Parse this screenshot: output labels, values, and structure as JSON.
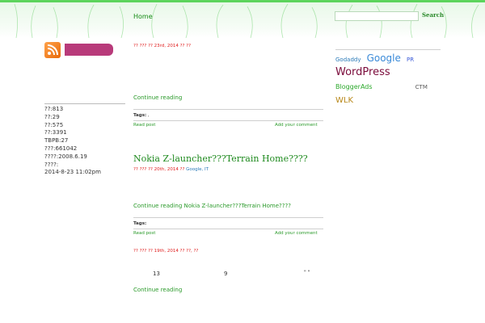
{
  "header": {
    "logo": "",
    "tagline": "",
    "nav": [
      {
        "label": "Home",
        "active": true
      },
      {
        "label": "",
        "active": false
      },
      {
        "label": "",
        "active": false
      },
      {
        "label": "",
        "active": false
      }
    ],
    "search": {
      "placeholder": "",
      "button": "Search"
    }
  },
  "sidebar": {
    "rss_label": "",
    "heading": "",
    "stats": [
      "??:813",
      "??:29",
      "??:575",
      "??:3391",
      "TBPB:27",
      "???:661042",
      "????:2008.6.19",
      "????:",
      "2014-8-23 11:02pm"
    ]
  },
  "posts": [
    {
      "title": "",
      "meta": "?? ??? ?? 23rd, 2014 ?? ??",
      "meta_link": "",
      "body": "",
      "more": "Continue reading ",
      "tags_label": "Tags:",
      "tags": [],
      "read": "Read post",
      "comment": "Add your comment"
    },
    {
      "title": "Nokia Z-launcher???Terrain Home????",
      "meta": "?? ??? ?? 20th, 2014 ?? ",
      "meta_link": "Google, IT",
      "body": "",
      "more": "Continue reading Nokia Z-launcher???Terrain Home????",
      "tags_label": "Tags:",
      "read": "Read post",
      "comment": "Add your comment"
    },
    {
      "title": "",
      "meta": "?? ??? ?? 19th, 2014 ?? ??, ??",
      "numbers": [
        "13",
        "9",
        "\" \""
      ],
      "more": "Continue reading "
    }
  ],
  "tagcloud": {
    "title": "",
    "tags": [
      {
        "label": "Godaddy",
        "size": 7,
        "color": "#2a7ab8"
      },
      {
        "label": "Google",
        "size": 12,
        "color": "#3a8ad8"
      },
      {
        "label": "PR",
        "size": 7,
        "color": "#3a5ad8"
      },
      {
        "label": "WordPress",
        "size": 13,
        "color": "#7a0a3a"
      },
      {
        "label": "",
        "size": 13,
        "color": "#1a3ad8"
      },
      {
        "label": "",
        "size": 8,
        "color": "#d83ab8"
      },
      {
        "label": "",
        "size": 6,
        "color": "#333333"
      },
      {
        "label": "",
        "size": 6,
        "color": "#333333"
      },
      {
        "label": "",
        "size": 7,
        "color": "#c87a1a"
      },
      {
        "label": "",
        "size": 6,
        "color": "#333333"
      },
      {
        "label": "",
        "size": 8,
        "color": "#5aa83a"
      },
      {
        "label": "",
        "size": 9,
        "color": "#1a3ad8"
      },
      {
        "label": "BloggerAds",
        "size": 8,
        "color": "#2aa82a"
      },
      {
        "label": "",
        "size": 7,
        "color": "#d8a81a"
      },
      {
        "label": "",
        "size": 8,
        "color": "#3a8ad8"
      },
      {
        "label": "",
        "size": 9,
        "color": "#3ab8d8"
      },
      {
        "label": "",
        "size": 6,
        "color": "#333333"
      },
      {
        "label": "",
        "size": 6,
        "color": "#333333"
      },
      {
        "label": "",
        "size": 9,
        "color": "#d83ab8"
      },
      {
        "label": "",
        "size": 6,
        "color": "#333333"
      },
      {
        "label": "",
        "size": 6,
        "color": "#d83a3a"
      },
      {
        "label": "",
        "size": 6,
        "color": "#333333"
      },
      {
        "label": "",
        "size": 7,
        "color": "#8ad83a"
      },
      {
        "label": "",
        "size": 6,
        "color": "#333333"
      },
      {
        "label": "",
        "size": 8,
        "color": "#d83a5a"
      },
      {
        "label": "",
        "size": 6,
        "color": "#d83ab8"
      },
      {
        "label": "",
        "size": 8,
        "color": "#3ab8d8"
      },
      {
        "label": "",
        "size": 8,
        "color": "#5a5ad8"
      },
      {
        "label": "",
        "size": 6,
        "color": "#333333"
      },
      {
        "label": "",
        "size": 6,
        "color": "#333333"
      },
      {
        "label": "",
        "size": 6,
        "color": "#333333"
      },
      {
        "label": "",
        "size": 6,
        "color": "#2aa82a"
      },
      {
        "label": "",
        "size": 6,
        "color": "#333333"
      },
      {
        "label": "",
        "size": 7,
        "color": "#2aa82a"
      },
      {
        "label": "",
        "size": 10,
        "color": "#7a1a3a"
      },
      {
        "label": "",
        "size": 6,
        "color": "#333333"
      },
      {
        "label": "CTM",
        "size": 7,
        "color": "#5a5a5a"
      },
      {
        "label": "",
        "size": 10,
        "color": "#d8a81a"
      },
      {
        "label": "WLK",
        "size": 10,
        "color": "#b8881a"
      }
    ]
  }
}
